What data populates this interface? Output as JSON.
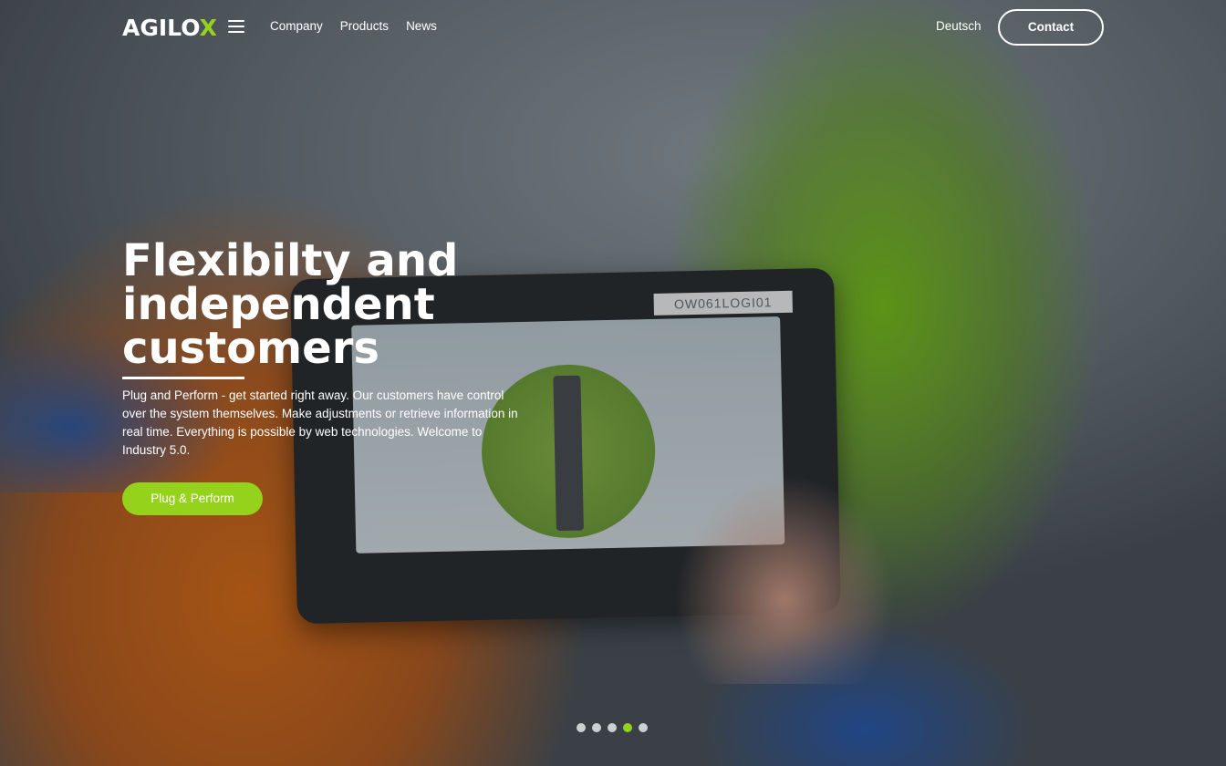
{
  "header": {
    "logo_text": "AGILO",
    "logo_accent": "X",
    "nav": [
      {
        "label": "Company"
      },
      {
        "label": "Products"
      },
      {
        "label": "News"
      }
    ],
    "language": "Deutsch",
    "contact_label": "Contact"
  },
  "hero": {
    "title": "Flexibilty and independent customers",
    "description": "Plug and Perform - get started right away. Our customers have control over the system themselves. Make adjustments or retrieve information in real time. Everything is possible by web technologies. Welcome to Industry 5.0.",
    "cta_label": "Plug & Perform",
    "device_tag": "OW061LOGI01"
  },
  "carousel": {
    "total_slides": 5,
    "active_slide": 4
  },
  "colors": {
    "accent": "#95d21b",
    "text": "#ffffff"
  },
  "icons": {
    "menu": "hamburger-icon"
  }
}
